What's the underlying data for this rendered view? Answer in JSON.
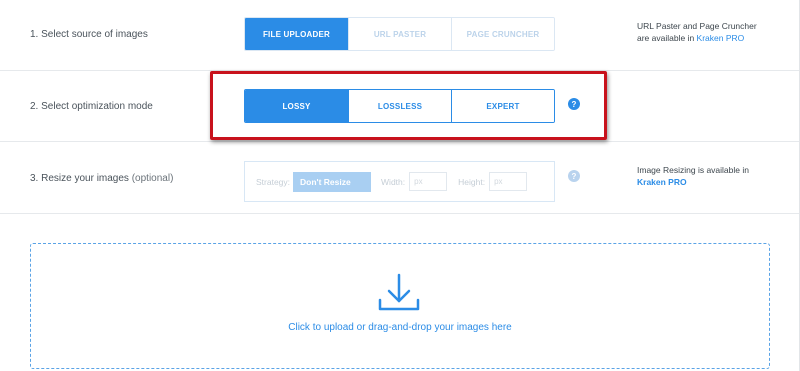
{
  "steps": {
    "source": {
      "label": "1. Select source of images",
      "options": [
        {
          "label": "FILE UPLOADER",
          "state": "active"
        },
        {
          "label": "URL PASTER",
          "state": "disabled"
        },
        {
          "label": "PAGE CRUNCHER",
          "state": "disabled"
        }
      ],
      "note_line1": "URL Paster and Page Cruncher",
      "note_prefix": "are available in ",
      "note_link": "Kraken PRO"
    },
    "mode": {
      "label": "2. Select optimization mode",
      "options": [
        {
          "label": "LOSSY",
          "state": "active"
        },
        {
          "label": "LOSSLESS",
          "state": "normal"
        },
        {
          "label": "EXPERT",
          "state": "normal"
        }
      ],
      "help": "?"
    },
    "resize": {
      "label": "3. Resize your images",
      "label_optional": "(optional)",
      "strategy_label": "Strategy:",
      "strategy_value": "Don't Resize",
      "width_label": "Width:",
      "width_placeholder": "px",
      "height_label": "Height:",
      "height_placeholder": "px",
      "help": "?",
      "note_line1": "Image Resizing is available in",
      "note_link": "Kraken PRO"
    }
  },
  "upload": {
    "text": "Click to upload or drag-and-drop your images here",
    "icon": "download-arrow-icon"
  },
  "colors": {
    "accent": "#2b8ce6",
    "highlight_frame": "#c8121c"
  }
}
